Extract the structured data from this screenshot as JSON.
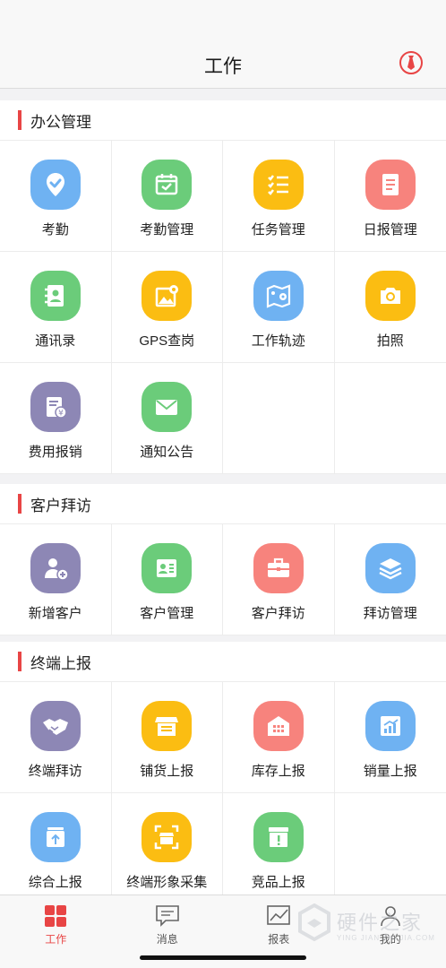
{
  "header": {
    "title": "工作",
    "right_icon": "tie-icon"
  },
  "colors": {
    "accent": "#e84545",
    "blue": "#6fb2f2",
    "green": "#6bcc7a",
    "yellow": "#fbbd12",
    "red": "#f7837d",
    "purple": "#8d87b5"
  },
  "sections": [
    {
      "title": "办公管理",
      "items": [
        {
          "label": "考勤",
          "icon": "location-check-icon",
          "color": "blue"
        },
        {
          "label": "考勤管理",
          "icon": "calendar-check-icon",
          "color": "green"
        },
        {
          "label": "任务管理",
          "icon": "checklist-icon",
          "color": "yellow"
        },
        {
          "label": "日报管理",
          "icon": "document-icon",
          "color": "red"
        },
        {
          "label": "通讯录",
          "icon": "contacts-book-icon",
          "color": "green"
        },
        {
          "label": "GPS查岗",
          "icon": "map-pin-image-icon",
          "color": "yellow"
        },
        {
          "label": "工作轨迹",
          "icon": "map-track-icon",
          "color": "blue"
        },
        {
          "label": "拍照",
          "icon": "camera-icon",
          "color": "yellow"
        },
        {
          "label": "费用报销",
          "icon": "receipt-yuan-icon",
          "color": "purple"
        },
        {
          "label": "通知公告",
          "icon": "envelope-icon",
          "color": "green"
        }
      ]
    },
    {
      "title": "客户拜访",
      "items": [
        {
          "label": "新增客户",
          "icon": "add-person-icon",
          "color": "purple"
        },
        {
          "label": "客户管理",
          "icon": "contact-card-icon",
          "color": "green"
        },
        {
          "label": "客户拜访",
          "icon": "briefcase-icon",
          "color": "red"
        },
        {
          "label": "拜访管理",
          "icon": "layers-icon",
          "color": "blue"
        }
      ]
    },
    {
      "title": "终端上报",
      "items": [
        {
          "label": "终端拜访",
          "icon": "handshake-icon",
          "color": "purple"
        },
        {
          "label": "铺货上报",
          "icon": "store-icon",
          "color": "yellow"
        },
        {
          "label": "库存上报",
          "icon": "warehouse-icon",
          "color": "red"
        },
        {
          "label": "销量上报",
          "icon": "sales-chart-icon",
          "color": "blue"
        },
        {
          "label": "综合上报",
          "icon": "upload-box-icon",
          "color": "blue"
        },
        {
          "label": "终端形象采集",
          "icon": "scan-store-icon",
          "color": "yellow"
        },
        {
          "label": "竞品上报",
          "icon": "alert-box-icon",
          "color": "green"
        }
      ]
    }
  ],
  "tabs": [
    {
      "label": "工作",
      "icon": "grid-icon",
      "active": true
    },
    {
      "label": "消息",
      "icon": "message-icon",
      "active": false
    },
    {
      "label": "报表",
      "icon": "chart-icon",
      "active": false
    },
    {
      "label": "我的",
      "icon": "person-icon",
      "active": false
    }
  ],
  "watermark": {
    "text": "硬件之家",
    "subtext": "YING JIAN ZHI JIA.COM"
  }
}
